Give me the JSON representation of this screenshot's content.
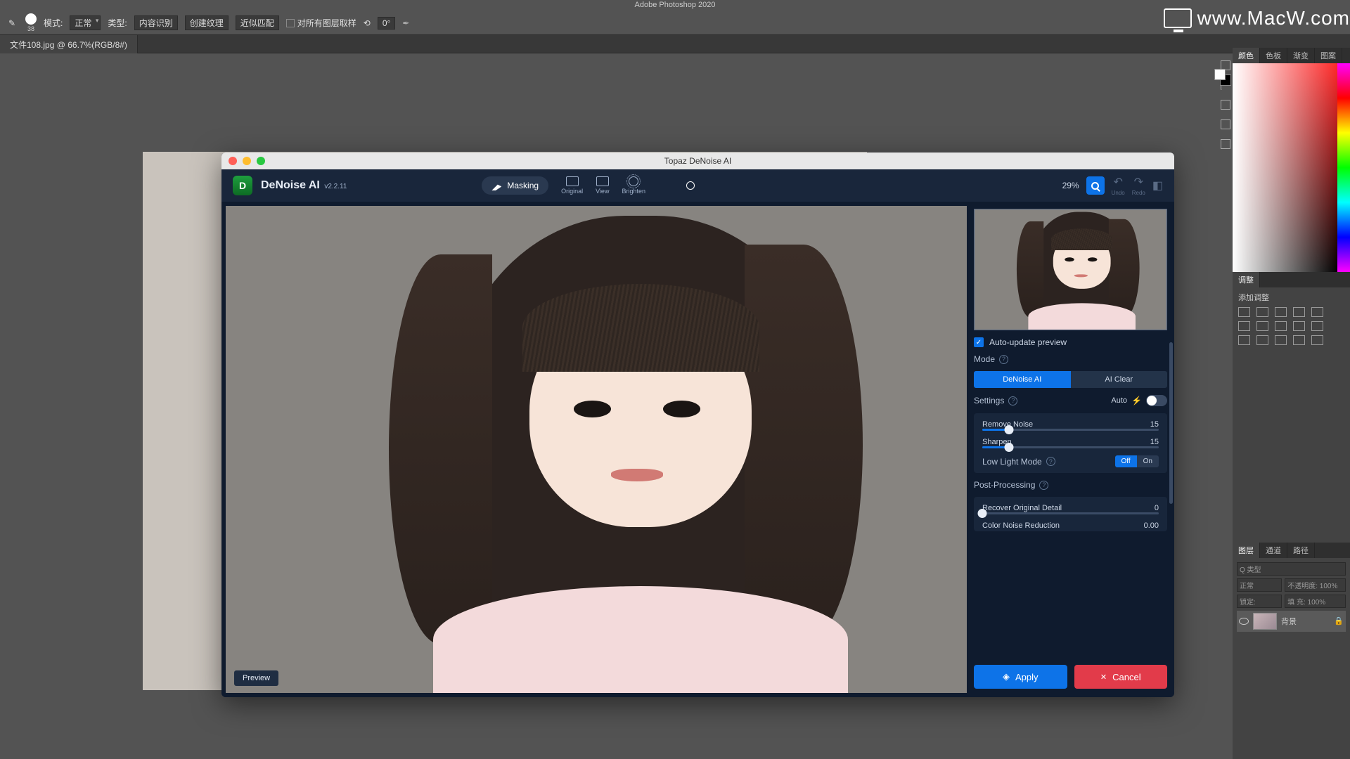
{
  "ps": {
    "app_title": "Adobe Photoshop 2020",
    "watermark": "www.MacW.com",
    "brush_size": "38",
    "mode_label": "模式:",
    "mode_value": "正常",
    "type_label": "类型:",
    "type_buttons": [
      "内容识别",
      "创建纹理",
      "近似匹配"
    ],
    "sample_all": "对所有图层取样",
    "angle_icon": "⟲",
    "angle": "0°",
    "tab": "文件108.jpg @ 66.7%(RGB/8#)",
    "panels": {
      "color_tabs": [
        "颜色",
        "色板",
        "渐变",
        "图案"
      ],
      "adjust_tab": "调整",
      "adjust_hint": "添加调整",
      "layers_tabs": [
        "图层",
        "通道",
        "路径"
      ],
      "layer_filter": "Q 类型",
      "blend_mode": "正常",
      "opacity_label": "不透明度: 100%",
      "lock_label": "锁定:",
      "fill_label": "填 充: 100%",
      "layer_name": "背景"
    }
  },
  "topaz": {
    "title": "Topaz DeNoise AI",
    "brand": "DeNoise AI",
    "version": "v2.2.11",
    "masking": "Masking",
    "views": {
      "original": "Original",
      "view": "View",
      "brighten": "Brighten"
    },
    "zoom": "29%",
    "undo": "Undo",
    "redo": "Redo",
    "auto_update": "Auto-update preview",
    "mode_label": "Mode",
    "modes": {
      "denoise": "DeNoise AI",
      "clear": "AI Clear"
    },
    "settings_label": "Settings",
    "auto_label": "Auto",
    "sliders": {
      "remove_noise": {
        "label": "Remove Noise",
        "value": "15",
        "pct": 15
      },
      "sharpen": {
        "label": "Sharpen",
        "value": "15",
        "pct": 15
      },
      "low_light": "Low Light Mode",
      "off": "Off",
      "on": "On"
    },
    "post_label": "Post-Processing",
    "post": {
      "recover": {
        "label": "Recover Original Detail",
        "value": "0",
        "pct": 0
      },
      "color_noise": {
        "label": "Color Noise Reduction",
        "value": "0.00"
      }
    },
    "apply": "Apply",
    "cancel": "Cancel",
    "preview_tag": "Preview"
  }
}
